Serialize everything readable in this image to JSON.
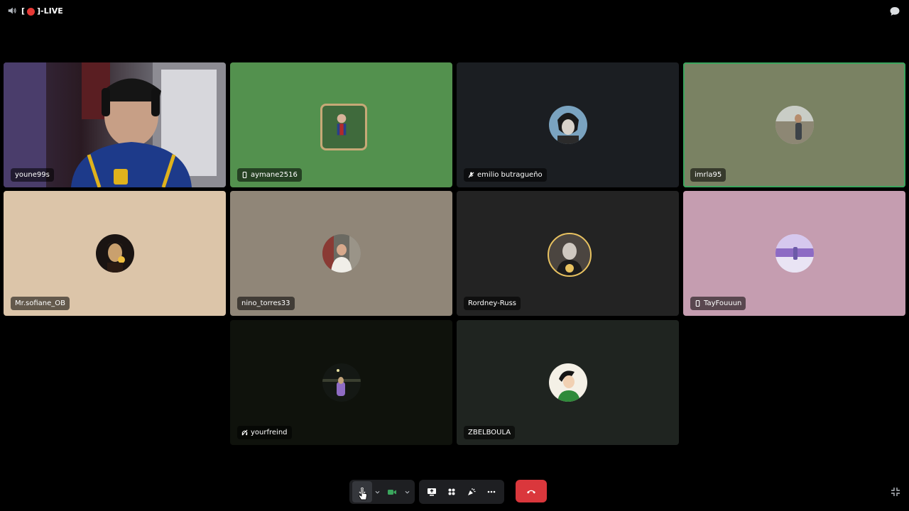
{
  "channel": {
    "prefix": "[",
    "suffix": "]-LIVE"
  },
  "colors": {
    "speaking": "#3ba55d",
    "leave": "#da373c",
    "live": "#e53935"
  },
  "participants": [
    {
      "name": "youne99s",
      "icon": "",
      "bg": "#2a2230",
      "streaming": true
    },
    {
      "name": "aymane2516",
      "icon": "phone-icon",
      "bg": "#53914e"
    },
    {
      "name": "emilio butragueño",
      "icon": "muted-mic-icon",
      "bg": "#1b1e22"
    },
    {
      "name": "imrla95",
      "icon": "",
      "bg": "#7a8263",
      "speaking": true
    },
    {
      "name": "Mr.sofiane_OB",
      "icon": "",
      "bg": "#dcc5a9"
    },
    {
      "name": "nino_torres33",
      "icon": "",
      "bg": "#908678"
    },
    {
      "name": "Rordney-Russ",
      "icon": "",
      "bg": "#232323"
    },
    {
      "name": "TayFouuun",
      "icon": "phone-icon",
      "bg": "#c59db0"
    },
    {
      "name": "yourfreind",
      "icon": "deafened-icon",
      "bg": "#0f120c"
    },
    {
      "name": "ZBELBOULA",
      "icon": "",
      "bg": "#1f2420"
    }
  ],
  "controls": {
    "mic": "microphone-icon",
    "camera": "camera-icon",
    "share": "screen-share-icon",
    "activities": "activities-icon",
    "soundboard": "soundboard-icon",
    "more": "more-icon",
    "leave": "hang-up-icon"
  }
}
